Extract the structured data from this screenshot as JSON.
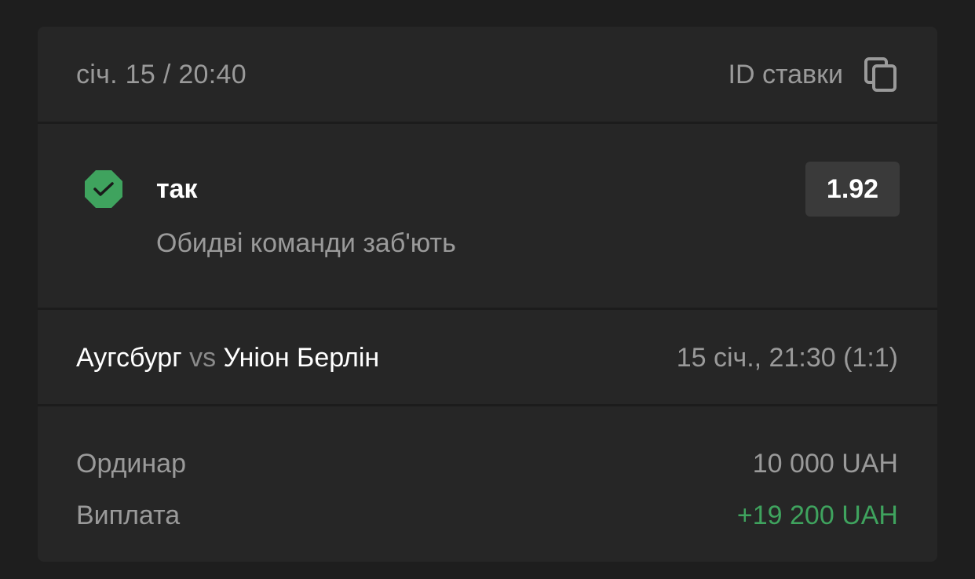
{
  "header": {
    "date": "січ. 15 / 20:40",
    "bet_id_label": "ID ставки",
    "copy_icon": "copy-icon"
  },
  "selection": {
    "status_icon": "check-badge-icon",
    "status_color": "#3fa35e",
    "pick": "так",
    "market": "Обидві команди заб'ють",
    "odds": "1.92"
  },
  "match": {
    "home_team": "Аугсбург",
    "vs": "vs",
    "away_team": "Уніон Берлін",
    "time_score": "15 січ., 21:30 (1:1)"
  },
  "summary": {
    "type_label": "Ординар",
    "stake": "10 000 UAH",
    "payout_label": "Виплата",
    "payout": "+19 200 UAH",
    "payout_color": "#3fa35e"
  }
}
